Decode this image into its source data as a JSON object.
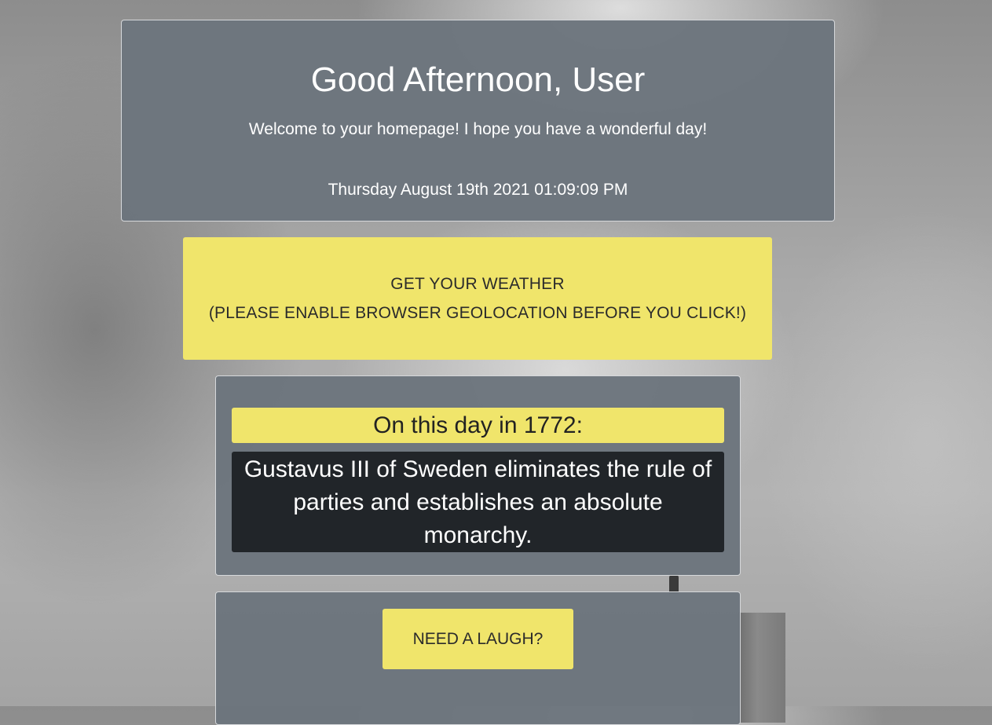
{
  "greeting": {
    "title": "Good Afternoon, User",
    "welcome": "Welcome to your homepage! I hope you have a wonderful day!",
    "datetime": "Thursday August 19th 2021 01:09:09 PM"
  },
  "weather": {
    "line1": "GET YOUR WEATHER",
    "line2": "(PLEASE ENABLE BROWSER GEOLOCATION BEFORE YOU CLICK!)"
  },
  "on_this_day": {
    "heading": "On this day in 1772:",
    "fact": "Gustavus III of Sweden eliminates the rule of parties and establishes an absolute monarchy."
  },
  "joke": {
    "button_label": "NEED A LAUGH?"
  },
  "colors": {
    "panel": "#6c757d",
    "accent_yellow": "#f0e56b",
    "dark_box": "#212529"
  }
}
